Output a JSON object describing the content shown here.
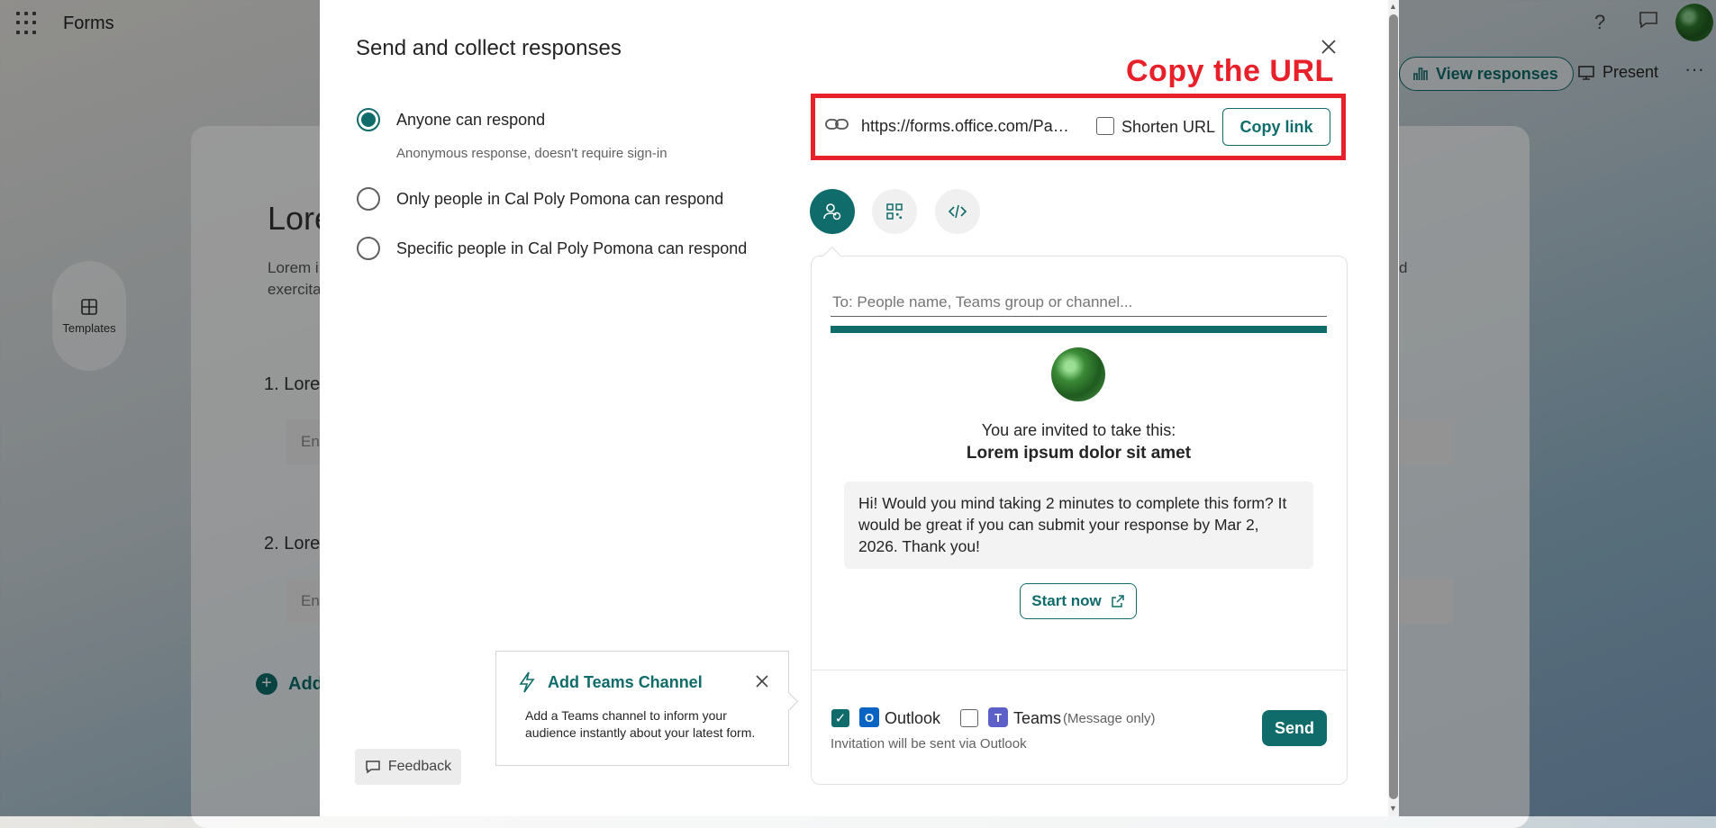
{
  "app": {
    "name": "Forms",
    "help_icon": "?",
    "view_responses_label": "View responses",
    "present_label": "Present",
    "more_icon": "···",
    "templates_label": "Templates"
  },
  "background_form": {
    "title_fragment": "Lore",
    "desc_line1_fragment": "Lorem i",
    "desc_line2_fragment": "exercita",
    "right_fragment": "d",
    "q1_fragment": "1. Lore",
    "q2_fragment": "2. Lore",
    "input_fragment": "Ent",
    "add_fragment": "Add"
  },
  "dialog": {
    "title": "Send and collect responses",
    "annotation": "Copy the URL",
    "options": [
      {
        "label": "Anyone can respond",
        "sublabel": "Anonymous response, doesn't require sign-in",
        "selected": true
      },
      {
        "label": "Only people in Cal Poly Pomona can respond",
        "selected": false
      },
      {
        "label": "Specific people in Cal Poly Pomona can respond",
        "selected": false
      }
    ],
    "link": {
      "url": "https://forms.office.com/Pages/ResponsePage.aspx",
      "shorten_label": "Shorten URL",
      "shorten_checked": false,
      "copy_label": "Copy link"
    },
    "share_tabs": [
      "invite-people",
      "qr-code",
      "embed"
    ],
    "invite": {
      "to_placeholder": "To: People name, Teams group or channel...",
      "invited_text": "You are invited to take this:",
      "form_title": "Lorem ipsum dolor sit amet",
      "message": "Hi! Would you mind taking 2 minutes to complete this form? It would be great if you can submit your response by Mar 2, 2026. Thank you!",
      "start_label": "Start now",
      "outlook_label": "Outlook",
      "outlook_checked": true,
      "teams_label": "Teams",
      "teams_note": "(Message only)",
      "teams_checked": false,
      "via_text": "Invitation will be sent via Outlook",
      "send_label": "Send"
    },
    "teams_card": {
      "title": "Add Teams Channel",
      "body": "Add a Teams channel to inform your audience instantly about your latest form."
    },
    "feedback_label": "Feedback"
  },
  "colors": {
    "accent": "#0f6c6a",
    "annotation_red": "#e8202a"
  }
}
